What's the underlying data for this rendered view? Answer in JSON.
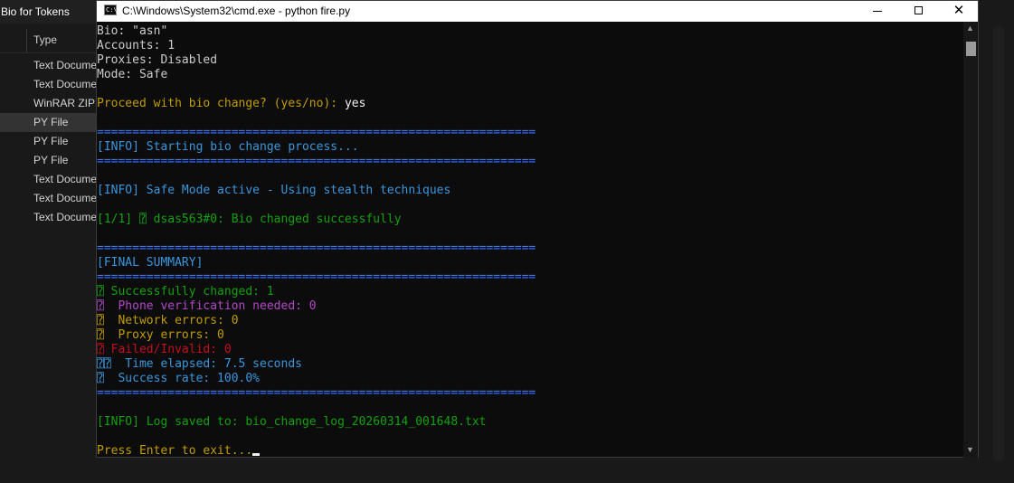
{
  "explorer": {
    "title": "g Bio for Tokens",
    "column_header": "Type",
    "rows": [
      {
        "type": "Text Document"
      },
      {
        "type": "Text Document"
      },
      {
        "type": "WinRAR ZIP archive"
      },
      {
        "type": "PY File"
      },
      {
        "type": "PY File"
      },
      {
        "type": "PY File"
      },
      {
        "type": "Text Document"
      },
      {
        "type": "Text Document"
      },
      {
        "type": "Text Document"
      }
    ]
  },
  "cmd": {
    "title": "C:\\Windows\\System32\\cmd.exe - python  fire.py",
    "icon_text": "C:\\",
    "buttons": {
      "minimize": "—",
      "maximize": "☐",
      "close": "✕"
    },
    "lines": {
      "bio": "Bio: \"asn\"",
      "accounts": "Accounts: 1",
      "proxies": "Proxies: Disabled",
      "mode": "Mode: Safe",
      "proceed_prompt": "Proceed with bio change? (yes/no): ",
      "proceed_answer": "yes",
      "separator": "==============================================================",
      "starting": "[INFO] Starting bio change process...",
      "safe_mode": "[INFO] Safe Mode active - Using stealth techniques",
      "result": "[1/1] ⍰ dsas563#0: Bio changed successfully",
      "final_summary": "[FINAL SUMMARY]",
      "success": "⍰ Successfully changed: 1",
      "phone": "⍰  Phone verification needed: 0",
      "network": "⍰  Network errors: 0",
      "proxy": "⍰  Proxy errors: 0",
      "failed": "⍰ Failed/Invalid: 0",
      "time": "⍰⍰  Time elapsed: 7.5 seconds",
      "rate": "⍰  Success rate: 100.0%",
      "log_saved": "[INFO] Log saved to: bio_change_log_20260314_001648.txt",
      "exit": "Press Enter to exit..."
    }
  }
}
